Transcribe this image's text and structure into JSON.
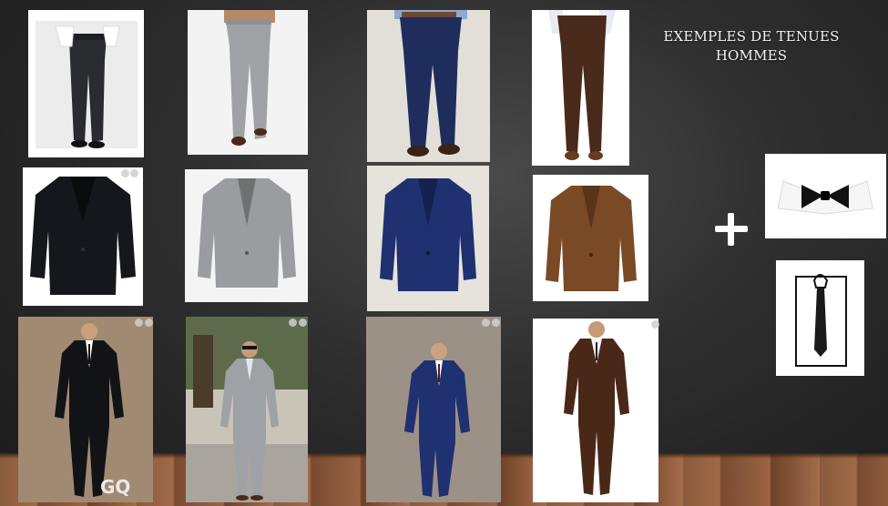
{
  "slide": {
    "title": "EXEMPLES DE TENUES HOMMES",
    "plus_symbol": "+",
    "watermark": "GQ"
  },
  "images": {
    "row_pants": [
      "black-pants-photo",
      "grey-pants-photo",
      "navy-pants-photo",
      "brown-pants-photo"
    ],
    "row_jackets": [
      "black-jacket-photo",
      "grey-jacket-photo",
      "navy-jacket-photo",
      "brown-jacket-photo"
    ],
    "row_suits": [
      "black-suit-model-photo",
      "grey-suit-model-photo",
      "navy-suit-model-photo",
      "brown-suit-model-photo"
    ],
    "accessories": [
      "bow-tie-photo",
      "necktie-photo"
    ]
  },
  "colors": {
    "black": "#15171c",
    "grey": "#9a9c9f",
    "navy": "#1e2d5c",
    "brown": "#5b3420",
    "floor": "#8a5a3c"
  }
}
